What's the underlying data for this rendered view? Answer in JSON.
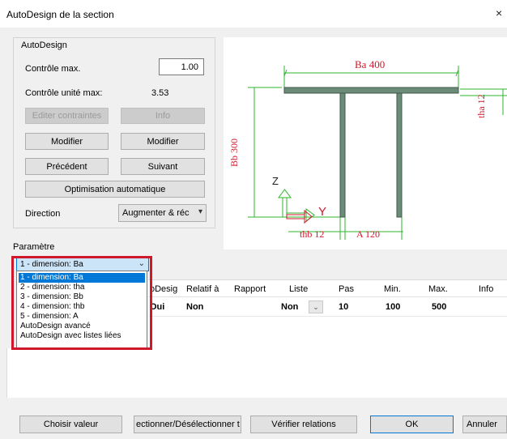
{
  "window": {
    "title": "AutoDesign de la section",
    "close_glyph": "×"
  },
  "autodesign": {
    "group_label": "AutoDesign",
    "max_check_label": "Contrôle max.",
    "max_check_value": "1.00",
    "max_unit_check_label": "Contrôle unité max:",
    "max_unit_check_value": "3.53",
    "edit_constraints_btn": "Editer contraintes",
    "info_btn": "Info",
    "modify_left_btn": "Modifier",
    "modify_right_btn": "Modifier",
    "previous_btn": "Précédent",
    "next_btn": "Suivant",
    "auto_opt_btn": "Optimisation automatique",
    "direction_label": "Direction",
    "direction_value": "Augmenter & réc"
  },
  "drawing": {
    "ba_label": "Ba 400",
    "tha_label": "tha 12",
    "bb_label": "Bb 300",
    "thb_label": "thb 12",
    "a_label": "A 120",
    "z_axis": "Z",
    "y_axis": "Y",
    "line_color": "#2bb52b",
    "label_color": "#d0182b",
    "section_fill": "#6b8c78"
  },
  "parametre": {
    "label": "Paramètre",
    "selected": "1 - dimension: Ba",
    "options": [
      "1 - dimension: Ba",
      "2 - dimension: tha",
      "3 - dimension: Bb",
      "4 - dimension: thb",
      "5 - dimension: A",
      "AutoDesign avancé",
      "AutoDesign avec listes liées"
    ]
  },
  "grid": {
    "headers": [
      "oDesig",
      "Relatif à",
      "Rapport",
      "Liste",
      "Pas",
      "Min.",
      "Max.",
      "Info"
    ],
    "row": {
      "autodesign": "Oui",
      "relatif": "Non",
      "liste": "Non",
      "pas": "10",
      "min": "100",
      "max": "500"
    }
  },
  "footer": {
    "choose_value": "Choisir valeur",
    "select_deselect": "ectionner/Désélectionner t",
    "verify_relations": "Vérifier relations",
    "ok": "OK",
    "cancel": "Annuler"
  }
}
